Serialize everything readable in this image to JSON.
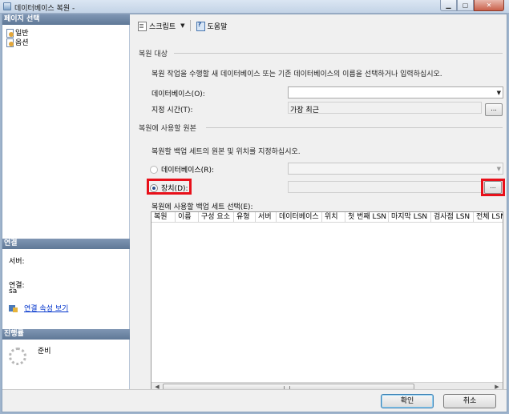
{
  "window": {
    "title": "데이터베이스 복원 -"
  },
  "left": {
    "page_select_header": "페이지 선택",
    "pages": [
      "일반",
      "옵션"
    ],
    "connection_header": "연결",
    "server_label": "서버:",
    "connection_label": "연결:",
    "connection_user": "sa",
    "view_connection_link": "연결 속성 보기",
    "progress_header": "진행률",
    "progress_status": "준비"
  },
  "toolbar": {
    "script_label": "스크립트",
    "help_label": "도움말"
  },
  "restore_target": {
    "section_title": "복원 대상",
    "description": "복원 작업을 수행할 새 데이터베이스 또는 기존 데이터베이스의 이름을 선택하거나 입력하십시오.",
    "database_label": "데이터베이스(O):",
    "database_value": "",
    "point_in_time_label": "지정 시간(T):",
    "point_in_time_value": "가장 최근"
  },
  "restore_source": {
    "section_title": "복원에 사용할 원본",
    "description": "복원할 백업 세트의 원본 및 위치를 지정하십시오.",
    "from_database_label": "데이터베이스(R):",
    "from_device_label": "장치(D):",
    "selected_option": "device",
    "backup_sets_label": "복원에 사용할 백업 세트 선택(E):",
    "columns": [
      "복원",
      "이름",
      "구성 요소",
      "유형",
      "서버",
      "데이터베이스",
      "위치",
      "첫 번째 LSN",
      "마지막 LSN",
      "검사점 LSN",
      "전체 LSN"
    ],
    "rows": []
  },
  "buttons": {
    "browse": "...",
    "ok": "확인",
    "cancel": "취소"
  },
  "window_buttons": {
    "minimize": "▁",
    "maximize": "▢",
    "close": "✕"
  }
}
